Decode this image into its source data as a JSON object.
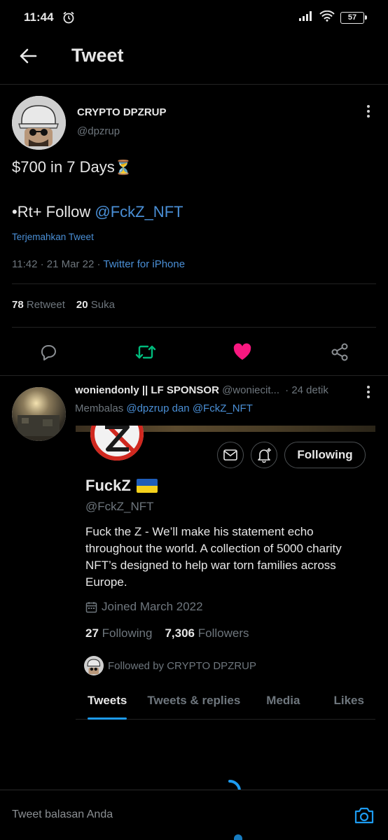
{
  "status_bar": {
    "time": "11:44",
    "battery": "57"
  },
  "header": {
    "title": "Tweet"
  },
  "tweet": {
    "author_name": "CRYPTO DPZRUP",
    "author_handle": "@dpzrup",
    "line1": "$700 in 7 Days",
    "line1_emoji": "⏳",
    "line2_prefix": "•Rt+ Follow ",
    "line2_mention": "@FckZ_NFT",
    "translate": "Terjemahkan Tweet",
    "time": "11:42 · 21 Mar 22 · ",
    "source": "Twitter for iPhone",
    "retweets_count": "78",
    "retweets_label": "Retweet",
    "likes_count": "20",
    "likes_label": "Suka"
  },
  "reply": {
    "name": "woniendonly || LF SPONSOR",
    "handle": "@woniecit...",
    "time": "· 24 detik",
    "replying_prefix": "Membalas ",
    "replying_users": "@dpzrup dan @FckZ_NFT"
  },
  "card": {
    "following_label": "Following",
    "name": "FuckZ",
    "handle": "@FckZ_NFT",
    "bio": "Fuck the Z -  We’ll make his statement echo throughout the world. A collection of 5000 charity NFT’s designed to help war torn families across Europe.",
    "joined": "Joined March 2022",
    "following_count": "27",
    "following_text": "Following",
    "followers_count": "7,306",
    "followers_text": "Followers",
    "followed_by": "Followed by CRYPTO DPZRUP",
    "tabs": [
      "Tweets",
      "Tweets & replies",
      "Media",
      "Likes"
    ]
  },
  "composer": {
    "placeholder": "Tweet balasan Anda"
  },
  "colors": {
    "accent": "#1d9bf0",
    "link": "#4a8fd6",
    "like": "#f91880",
    "retweet": "#00ba7c"
  }
}
